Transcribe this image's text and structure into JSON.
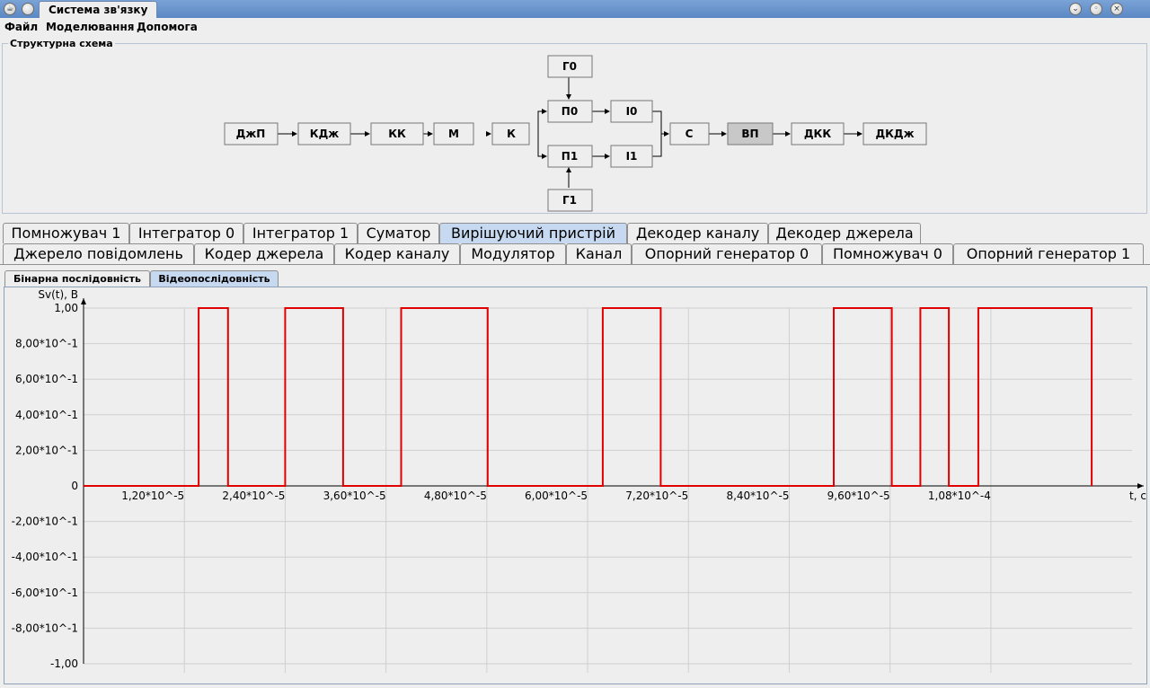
{
  "window": {
    "title": "Система зв'язку"
  },
  "menu": [
    "Файл",
    "Моделювання",
    "Допомога"
  ],
  "scheme": {
    "title": "Структурна схема",
    "blocks": {
      "djp": "ДжП",
      "kdj": "КДж",
      "kk": "КК",
      "m": "М",
      "k": "К",
      "g0": "Г0",
      "p0": "П0",
      "i0": "І0",
      "p1": "П1",
      "i1": "І1",
      "g1": "Г1",
      "s": "С",
      "vp": "ВП",
      "dkk": "ДКК",
      "dkdj": "ДКДж"
    },
    "highlighted": "ВП",
    "highlight_color": "#c8c8c8"
  },
  "tabs": {
    "row1": [
      "Помножувач 1",
      "Інтегратор 0",
      "Інтегратор 1",
      "Суматор",
      "Вирішуючий пристрій",
      "Декодер каналу",
      "Декодер джерела"
    ],
    "row2": [
      "Джерело повідомлень",
      "Кодер джерела",
      "Кодер каналу",
      "Модулятор",
      "Канал",
      "Опорний генератор 0",
      "Помножувач 0",
      "Опорний генератор 1"
    ],
    "selected": "Вирішуючий пристрій"
  },
  "subtabs": {
    "items": [
      "Бінарна послідовність",
      "Відеопослідовність"
    ],
    "selected": "Відеопослідовність"
  },
  "chart_data": {
    "type": "line",
    "ylabel": "Sv(t), В",
    "xlabel": "t, с",
    "xlim": [
      0,
      0.0001248
    ],
    "ylim": [
      -1,
      1
    ],
    "x_ticks": [
      "1,20*10^-5",
      "2,40*10^-5",
      "3,60*10^-5",
      "4,80*10^-5",
      "6,00*10^-5",
      "7,20*10^-5",
      "8,40*10^-5",
      "9,60*10^-5",
      "1,08*10^-4"
    ],
    "y_ticks": [
      "1,00",
      "8,00*10^-1",
      "6,00*10^-1",
      "4,00*10^-1",
      "2,00*10^-1",
      "0",
      "-2,00*10^-1",
      "-4,00*10^-1",
      "-6,00*10^-1",
      "-8,00*10^-1",
      "-1,00"
    ],
    "line_color": "#e00000",
    "grid": true,
    "series": [
      {
        "x": [
          0,
          1.37e-05,
          1.37e-05,
          1.72e-05,
          1.72e-05,
          2.4e-05,
          2.4e-05,
          3.09e-05,
          3.09e-05,
          3.78e-05,
          3.78e-05,
          4.81e-05,
          4.81e-05,
          6.18e-05,
          6.18e-05,
          6.87e-05,
          6.87e-05,
          8.93e-05,
          8.93e-05,
          9.62e-05,
          9.62e-05,
          9.96e-05,
          9.96e-05,
          0.000103,
          0.000103,
          0.0001065,
          0.0001065,
          0.00012,
          0.00012
        ],
        "values": [
          0,
          0,
          1,
          1,
          0,
          0,
          1,
          1,
          0,
          0,
          1,
          1,
          0,
          0,
          1,
          1,
          0,
          0,
          1,
          1,
          0,
          0,
          1,
          1,
          0,
          0,
          1,
          1,
          0
        ]
      }
    ]
  }
}
